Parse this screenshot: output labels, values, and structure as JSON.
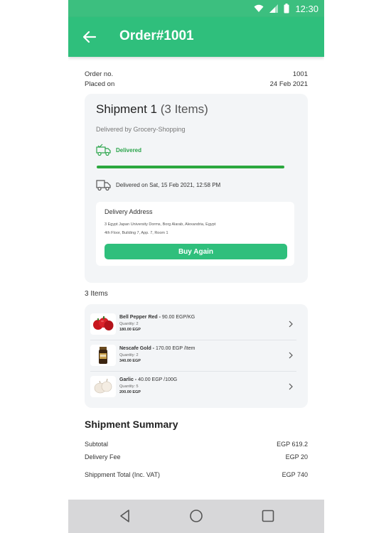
{
  "status_bar": {
    "time": "12:30"
  },
  "app_bar": {
    "title": "Order#1001"
  },
  "order_meta": [
    {
      "label": "Order no.",
      "value": "1001"
    },
    {
      "label": "Placed on",
      "value": "24 Feb 2021"
    }
  ],
  "shipment": {
    "title": "Shipment 1",
    "items_count": "(3 Items)",
    "delivered_by": "Delivered by Grocery-Shopping",
    "status": "Delivered",
    "progress": 1.0,
    "delivered_on": "Delivered on Sat, 15 Feb 2021, 12:58 PM",
    "address_label": "Delivery Address",
    "address_line1": "3 Egypt Japan University Dorms, Borg Alarab, Alexandria, Egypt",
    "address_line2": "4th Floor, Building 7, App. 7, Room 1",
    "buy_again": "Buy Again"
  },
  "items_heading": "3 Items",
  "items": [
    {
      "name": "Bell Pepper Red -",
      "price": " 90.00 EGP/KG",
      "quantity": "Quantity: 2",
      "total": "180.00 EGP"
    },
    {
      "name": "Nescafe Gold -",
      "price": " 170.00 EGP /Item",
      "quantity": "Quantity: 2",
      "total": "340.00 EGP"
    },
    {
      "name": "Garlic -",
      "price": " 40.00 EGP /100G",
      "quantity": "Quantity: 5",
      "total": "200.00 EGP"
    }
  ],
  "summary": {
    "title": "Shipment Summary",
    "rows": [
      {
        "label": "Subtotal",
        "value": "EGP 619.2"
      },
      {
        "label": "Delivery Fee",
        "value": "EGP 20"
      },
      {
        "label": "Shippment Total (Inc. VAT)",
        "value": "EGP 740"
      }
    ]
  },
  "colors": {
    "primary": "#2fbf7c",
    "status_bar": "#3cbf7f",
    "delivered": "#2aa44a",
    "card_bg": "#f3f5f7",
    "nav_bar": "#d7d7d9"
  },
  "icons": [
    "wifi-icon",
    "signal-icon",
    "battery-icon",
    "back-arrow-icon",
    "delivery-truck-icon",
    "delivery-van-icon",
    "chevron-right-icon",
    "nav-back-icon",
    "nav-home-icon",
    "nav-recents-icon"
  ]
}
